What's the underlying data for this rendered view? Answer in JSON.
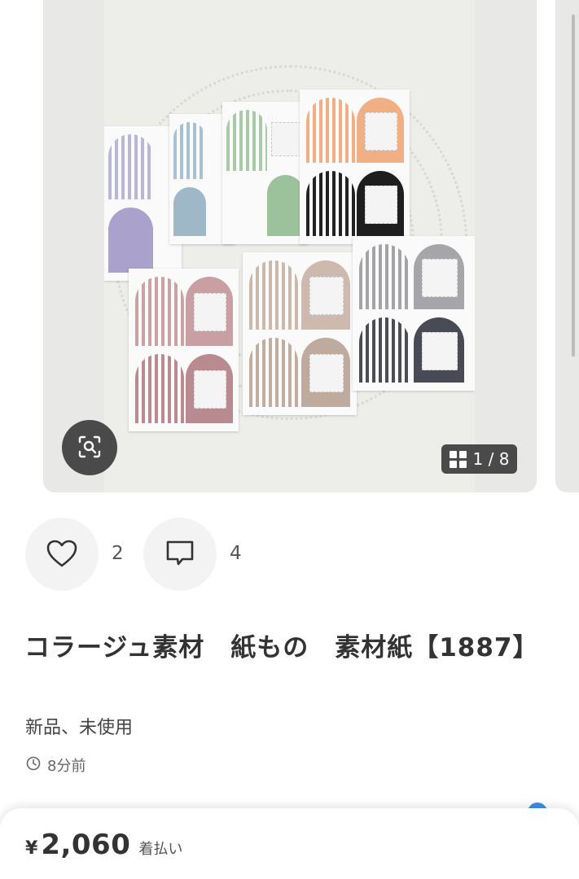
{
  "carousel": {
    "image_description_icon": "photo-of-paper-collage-sheets",
    "scan_icon": "image-search-icon",
    "counter": {
      "icon": "grid-icon",
      "text": "1 / 8"
    }
  },
  "actions": {
    "like": {
      "icon": "heart-icon",
      "count": "2"
    },
    "comment": {
      "icon": "speech-bubble-icon",
      "count": "4"
    }
  },
  "item": {
    "title": "コラージュ素材　紙もの　素材紙【1887】",
    "condition": "新品、未使用",
    "posted_icon": "clock-icon",
    "posted": "8分前"
  },
  "purchase": {
    "currency": "¥",
    "price": "2,060",
    "shipping": "着払い"
  },
  "colors": {
    "accent_blue": "#3b8fe0",
    "badge_bg": "#4a4a4a",
    "action_bg": "#f3f3f3"
  }
}
